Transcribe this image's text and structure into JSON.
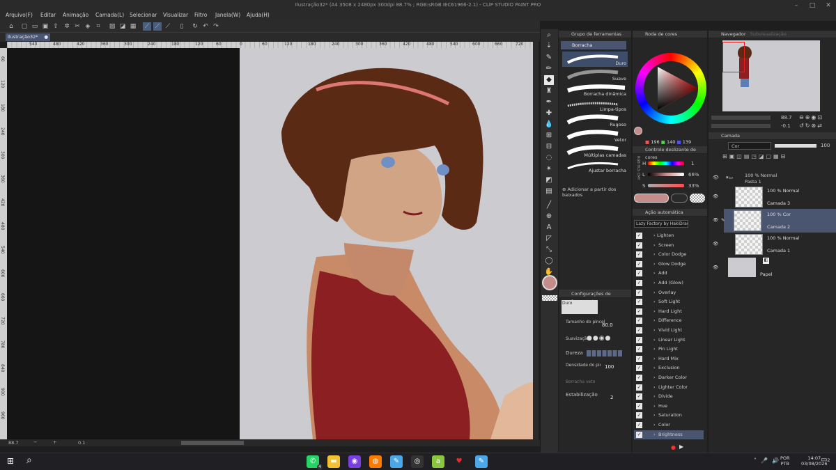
{
  "window": {
    "title": "Ilustração32* (A4 3508 x 2480px 300dpi 88.7% ; RGB:sRGB IEC61966-2.1) - CLIP STUDIO PAINT PRO"
  },
  "menu": [
    "Arquivo(F)",
    "Editar",
    "Animação",
    "Camada(L)",
    "Selecionar",
    "Visualizar",
    "Filtro",
    "Janela(W)",
    "Ajuda(H)"
  ],
  "doc_tab": "Ilustração32*",
  "ruler_h": [
    "540",
    "480",
    "420",
    "360",
    "300",
    "240",
    "180",
    "120",
    "60",
    "0",
    "60",
    "120",
    "180",
    "240",
    "300",
    "360",
    "420",
    "480",
    "540",
    "600",
    "660",
    "720"
  ],
  "ruler_v": [
    "60",
    "120",
    "180",
    "240",
    "300",
    "360",
    "420",
    "480",
    "540",
    "600",
    "660",
    "720",
    "780",
    "840",
    "900",
    "960"
  ],
  "status": {
    "zoom": "88.7",
    "angle": "0.1"
  },
  "subtool": {
    "header": "Grupo de ferramentas",
    "group": "Borracha",
    "items": [
      "Duro",
      "Suave",
      "Borracha dinâmica",
      "Limpa-tipos",
      "Rugoso",
      "Vetor",
      "Múltiplas camadas",
      "Ajustar borracha"
    ],
    "add_label": "Adicionar a partir dos baixados"
  },
  "tool_settings": {
    "header": "Configurações de ferramenta",
    "tool_name": "Duro",
    "brush_size_label": "Tamanho do pincel",
    "brush_size": "80.0",
    "smoothing_label": "Suavização",
    "hardness_label": "Dureza",
    "density_label": "Densidade do pincel",
    "density": "100",
    "vector_eraser_label": "Borracha vetorial",
    "stabilization_label": "Estabilização",
    "stabilization": "2"
  },
  "color_wheel": {
    "header": "Roda de cores",
    "r": "196",
    "g": "140",
    "b": "139",
    "current_color": "#c48c8b"
  },
  "color_slider": {
    "header": "Controle deslizante de cores",
    "h_label": "H",
    "h_value": "1",
    "l_label": "L",
    "l_value": "66%",
    "s_label": "S",
    "s_value": "33%",
    "tabs": [
      "RGB",
      "HLS",
      "CMY"
    ]
  },
  "auto_action": {
    "header": "Ação automática",
    "set_name": "Lazy Factory by HakiDraws",
    "items": [
      "Lighten",
      "Screen",
      "Color Dodge",
      "Glow Dodge",
      "Add",
      "Add (Glow)",
      "Overlay",
      "Soft Light",
      "Hard Light",
      "Difference",
      "Vivid Light",
      "Linear Light",
      "Pin Light",
      "Hard Mix",
      "Exclusion",
      "Darker Color",
      "Lighter Color",
      "Divide",
      "Hue",
      "Saturation",
      "Color",
      "Brightness"
    ]
  },
  "navigator": {
    "header": "Navegador",
    "tab2": "Subvisualização",
    "zoom": "88.7",
    "angle": "-0.1"
  },
  "layers": {
    "header": "Camada",
    "blend_mode": "Cor",
    "opacity": "100",
    "folder": {
      "mode": "100 % Normal",
      "name": "Pasta 1"
    },
    "items": [
      {
        "mode": "100 % Normal",
        "name": "Camada 3"
      },
      {
        "mode": "100 % Cor",
        "name": "Camada 2"
      },
      {
        "mode": "100 % Normal",
        "name": "Camada 1"
      },
      {
        "mode": "",
        "name": "Papel"
      }
    ]
  },
  "taskbar": {
    "whatsapp_badge": "4",
    "lang": "POR",
    "lang_sub": "PTB",
    "time": "14:07",
    "date": "03/08/2026",
    "notif_badge": "2"
  }
}
